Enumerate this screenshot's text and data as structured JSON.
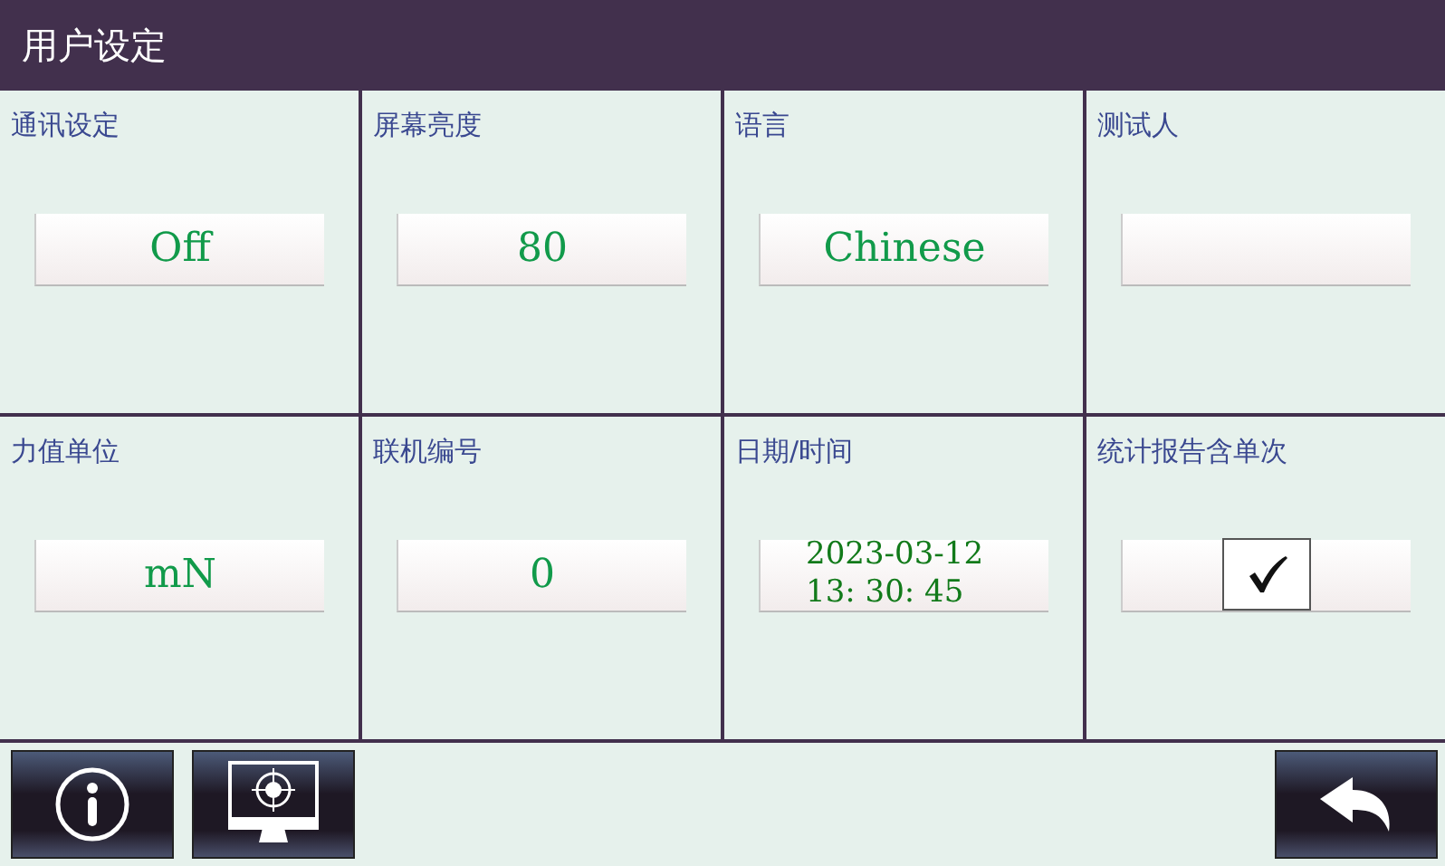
{
  "window": {
    "title": "用户设定"
  },
  "settings": [
    {
      "label": "通讯设定",
      "kind": "value",
      "value": "Off"
    },
    {
      "label": "屏幕亮度",
      "kind": "value",
      "value": "80"
    },
    {
      "label": "语言",
      "kind": "value",
      "value": "Chinese"
    },
    {
      "label": "测试人",
      "kind": "value"
    },
    {
      "label": "力值单位",
      "kind": "value",
      "value": "mN"
    },
    {
      "label": "联机编号",
      "kind": "value",
      "value": "0"
    },
    {
      "label": "日期/时间",
      "kind": "datetime",
      "date": "2023-03-12",
      "time": "13: 30: 45"
    },
    {
      "label": "统计报告含单次",
      "kind": "checkbox",
      "checked": true
    }
  ],
  "toolbar": [
    {
      "kind": "info"
    },
    {
      "kind": "monitor"
    },
    {
      "kind": "back"
    }
  ]
}
